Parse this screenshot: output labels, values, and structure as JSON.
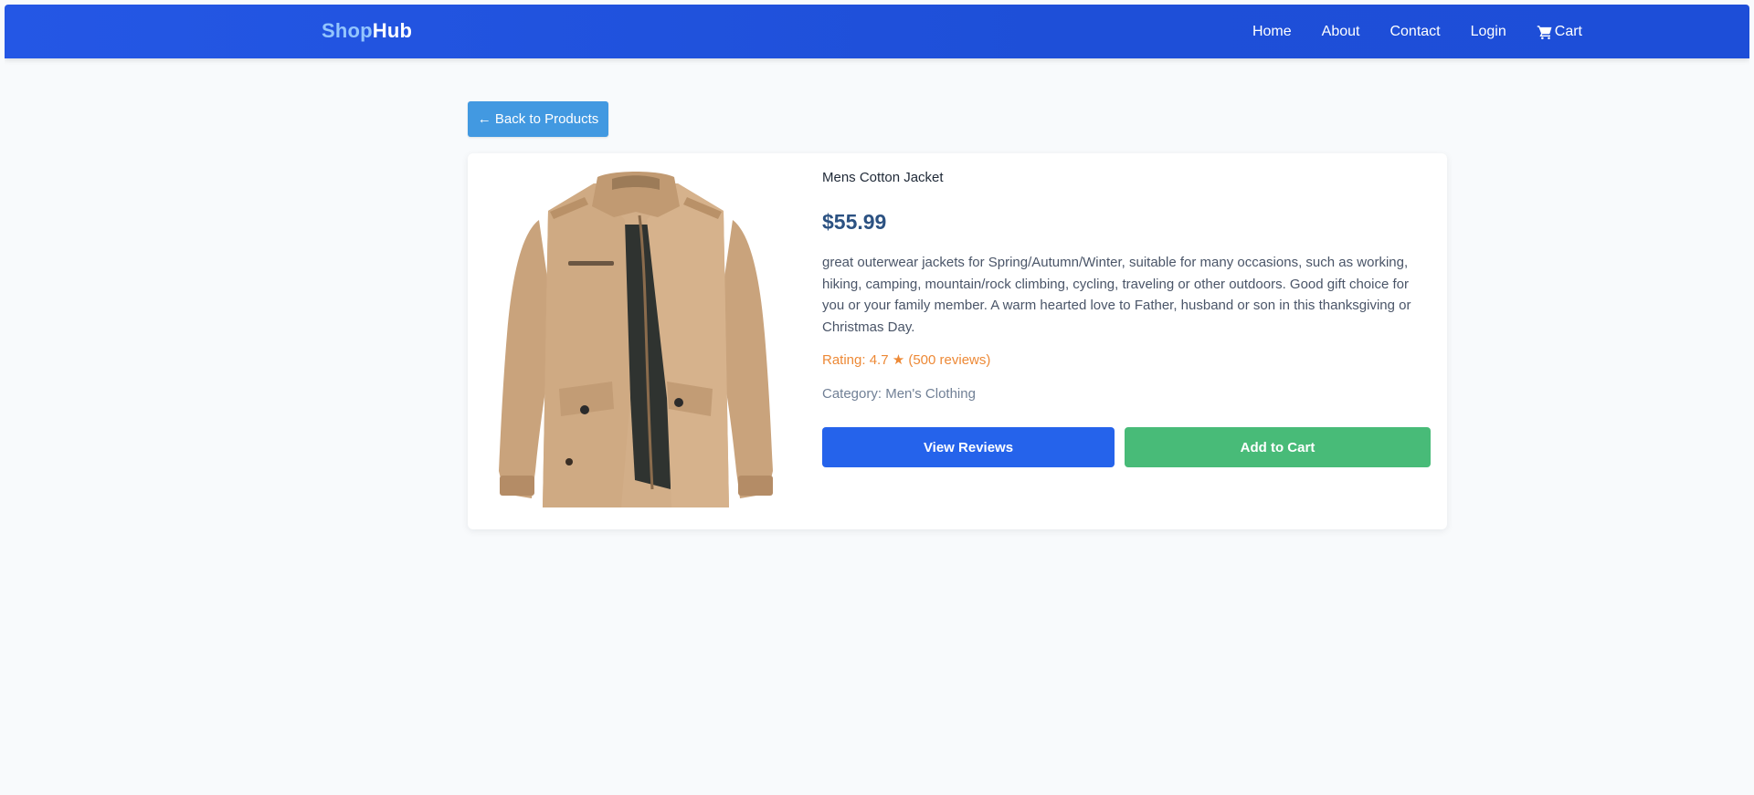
{
  "navbar": {
    "brand_part1": "Shop",
    "brand_part2": "Hub",
    "links": [
      {
        "label": "Home"
      },
      {
        "label": "About"
      },
      {
        "label": "Contact"
      },
      {
        "label": "Login"
      },
      {
        "label": "Cart",
        "icon": "cart-icon"
      }
    ]
  },
  "back_button": {
    "label": "← Back to Products"
  },
  "product": {
    "title": "Mens Cotton Jacket",
    "price": "$55.99",
    "description": "great outerwear jackets for Spring/Autumn/Winter, suitable for many occasions, such as working, hiking, camping, mountain/rock climbing, cycling, traveling or other outdoors. Good gift choice for you or your family member. A warm hearted love to Father, husband or son in this thanksgiving or Christmas Day.",
    "rating_text": "Rating: 4.7 ★ (500 reviews)",
    "category_text": "Category: Men's Clothing",
    "image_icon": "jacket-image"
  },
  "actions": {
    "view_reviews": "View Reviews",
    "add_to_cart": "Add to Cart"
  },
  "colors": {
    "navbar": "#1d4ed8",
    "back_button": "#4299e1",
    "price": "#2c5282",
    "rating": "#ed8936",
    "view_reviews_button": "#2563eb",
    "add_to_cart_button": "#48bb78"
  }
}
